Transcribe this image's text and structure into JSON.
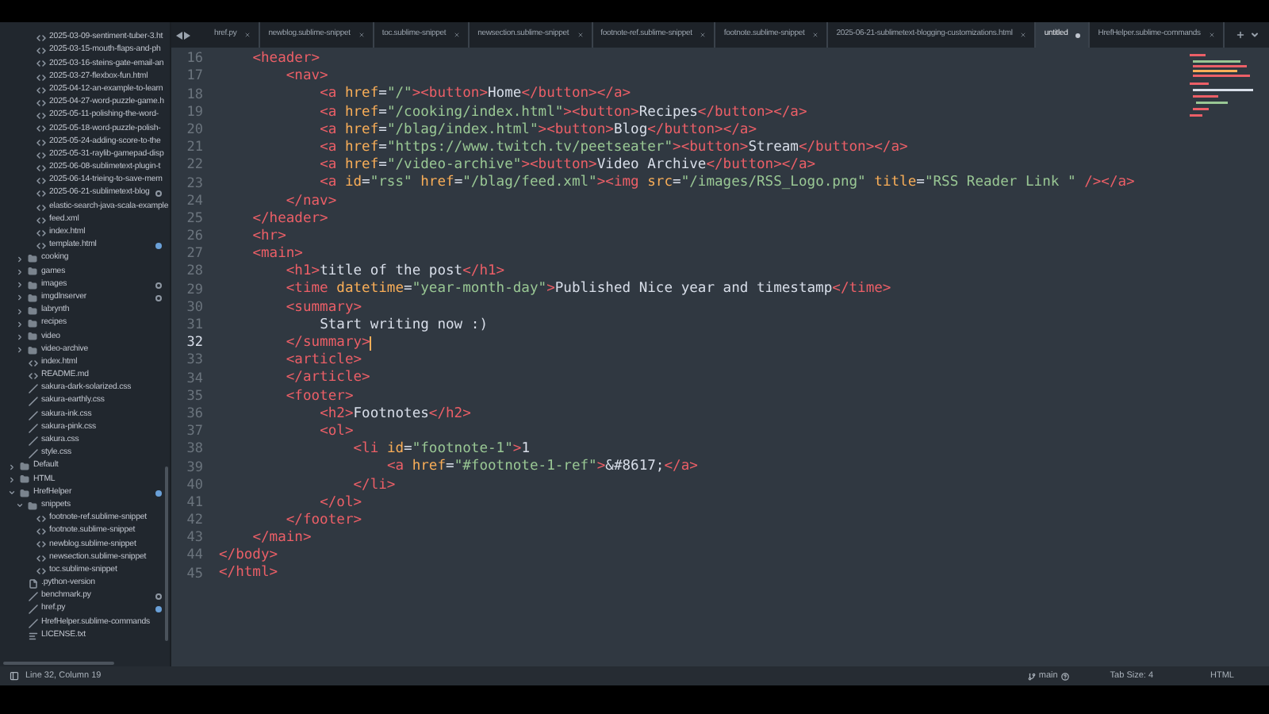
{
  "tabs": [
    {
      "label": "href.py",
      "selected": false,
      "modified": false
    },
    {
      "label": "newblog.sublime-snippet",
      "selected": false,
      "modified": false
    },
    {
      "label": "toc.sublime-snippet",
      "selected": false,
      "modified": false
    },
    {
      "label": "newsection.sublime-snippet",
      "selected": false,
      "modified": false
    },
    {
      "label": "footnote-ref.sublime-snippet",
      "selected": false,
      "modified": false
    },
    {
      "label": "footnote.sublime-snippet",
      "selected": false,
      "modified": false
    },
    {
      "label": "2025-06-21-sublimetext-blogging-customizations.html",
      "selected": false,
      "modified": false
    },
    {
      "label": "untitled",
      "selected": true,
      "modified": true
    },
    {
      "label": "HrefHelper.sublime-commands",
      "selected": false,
      "modified": false
    }
  ],
  "sidebar": {
    "items": [
      {
        "kind": "folder",
        "children": [
          {
            "kind": "folder",
            "children": [
              {
                "kind": "markup",
                "label": "2025-03-09-sentiment-tuber-3.ht",
                "modified": false,
                "untracked": false
              },
              {
                "kind": "markup",
                "label": "2025-03-15-mouth-flaps-and-ph",
                "modified": false,
                "untracked": false
              },
              {
                "kind": "markup",
                "label": "2025-03-16-steins-gate-email-an",
                "modified": false,
                "untracked": false
              },
              {
                "kind": "markup",
                "label": "2025-03-27-flexbox-fun.html",
                "modified": false,
                "untracked": false
              },
              {
                "kind": "markup",
                "label": "2025-04-12-an-example-to-learn",
                "modified": false,
                "untracked": false
              },
              {
                "kind": "markup",
                "label": "2025-04-27-word-puzzle-game.h",
                "modified": false,
                "untracked": false
              },
              {
                "kind": "markup",
                "label": "2025-05-11-polishing-the-word-",
                "modified": false,
                "untracked": false
              },
              {
                "kind": "markup",
                "label": "2025-05-18-word-puzzle-polish-",
                "modified": false,
                "untracked": false
              },
              {
                "kind": "markup",
                "label": "2025-05-24-adding-score-to-the",
                "modified": false,
                "untracked": false
              },
              {
                "kind": "markup",
                "label": "2025-05-31-raylib-gamepad-disp",
                "modified": false,
                "untracked": false
              },
              {
                "kind": "markup",
                "label": "2025-06-08-sublimetext-plugin-t",
                "modified": false,
                "untracked": false
              },
              {
                "kind": "markup",
                "label": "2025-06-14-trieing-to-save-mem",
                "modified": false,
                "untracked": false
              },
              {
                "kind": "markup",
                "label": "2025-06-21-sublimetext-blog",
                "modified": false,
                "untracked": true
              },
              {
                "kind": "markup",
                "label": "elastic-search-java-scala-example",
                "modified": false,
                "untracked": false
              },
              {
                "kind": "markup",
                "label": "feed.xml",
                "modified": false,
                "untracked": false
              },
              {
                "kind": "markup",
                "label": "index.html",
                "modified": false,
                "untracked": false
              },
              {
                "kind": "markup",
                "label": "template.html",
                "modified": true,
                "untracked": false
              }
            ]
          },
          {
            "kind": "folder",
            "label": "cooking",
            "expanded": false,
            "modified": false,
            "untracked": false
          },
          {
            "kind": "folder",
            "label": "games",
            "expanded": false,
            "modified": false,
            "untracked": false
          },
          {
            "kind": "folder",
            "label": "images",
            "expanded": false,
            "modified": false,
            "untracked": true
          },
          {
            "kind": "folder",
            "label": "imgdlnserver",
            "expanded": false,
            "modified": false,
            "untracked": true
          },
          {
            "kind": "folder",
            "label": "labrynth",
            "expanded": false,
            "modified": false,
            "untracked": false
          },
          {
            "kind": "folder",
            "label": "recipes",
            "expanded": false,
            "modified": false,
            "untracked": false
          },
          {
            "kind": "folder",
            "label": "video",
            "expanded": false,
            "modified": false,
            "untracked": false
          },
          {
            "kind": "folder",
            "label": "video-archive",
            "expanded": false,
            "modified": false,
            "untracked": false
          },
          {
            "kind": "markup",
            "label": "index.html",
            "modified": false,
            "untracked": false
          },
          {
            "kind": "markup",
            "label": "README.md",
            "modified": false,
            "untracked": false
          },
          {
            "kind": "script",
            "label": "sakura-dark-solarized.css",
            "modified": false,
            "untracked": false
          },
          {
            "kind": "script",
            "label": "sakura-earthly.css",
            "modified": false,
            "untracked": false
          },
          {
            "kind": "script",
            "label": "sakura-ink.css",
            "modified": false,
            "untracked": false
          },
          {
            "kind": "script",
            "label": "sakura-pink.css",
            "modified": false,
            "untracked": false
          },
          {
            "kind": "script",
            "label": "sakura.css",
            "modified": false,
            "untracked": false
          },
          {
            "kind": "script",
            "label": "style.css",
            "modified": false,
            "untracked": false
          }
        ]
      },
      {
        "kind": "folder",
        "label": "Default",
        "expanded": false,
        "modified": false,
        "untracked": false
      },
      {
        "kind": "folder",
        "label": "HTML",
        "expanded": false,
        "modified": false,
        "untracked": false
      },
      {
        "kind": "folder",
        "label": "HrefHelper",
        "expanded": true,
        "modified": true,
        "untracked": false,
        "children": [
          {
            "kind": "folder",
            "label": "snippets",
            "expanded": true,
            "modified": false,
            "untracked": false,
            "children": [
              {
                "kind": "markup",
                "label": "footnote-ref.sublime-snippet",
                "modified": false,
                "untracked": false
              },
              {
                "kind": "markup",
                "label": "footnote.sublime-snippet",
                "modified": false,
                "untracked": false
              },
              {
                "kind": "markup",
                "label": "newblog.sublime-snippet",
                "modified": false,
                "untracked": false
              },
              {
                "kind": "markup",
                "label": "newsection.sublime-snippet",
                "modified": false,
                "untracked": false
              },
              {
                "kind": "markup",
                "label": "toc.sublime-snippet",
                "modified": false,
                "untracked": false
              }
            ]
          },
          {
            "kind": "file",
            "label": ".python-version",
            "modified": false,
            "untracked": false
          },
          {
            "kind": "script",
            "label": "benchmark.py",
            "modified": false,
            "untracked": true
          },
          {
            "kind": "script",
            "label": "href.py",
            "modified": true,
            "untracked": false
          },
          {
            "kind": "script",
            "label": "HrefHelper.sublime-commands",
            "modified": false,
            "untracked": false
          },
          {
            "kind": "text",
            "label": "LICENSE.txt",
            "modified": false,
            "untracked": false
          }
        ]
      }
    ]
  },
  "editor": {
    "lines": [
      {
        "number": "16",
        "text": "    <header>",
        "current": false
      },
      {
        "number": "17",
        "text": "        <nav>",
        "current": false
      },
      {
        "number": "18",
        "text": "            <a href=\"/\"><button>Home</button></a>",
        "current": false
      },
      {
        "number": "19",
        "text": "            <a href=\"/cooking/index.html\"><button>Recipes</button></a>",
        "current": false
      },
      {
        "number": "20",
        "text": "            <a href=\"/blag/index.html\"><button>Blog</button></a>",
        "current": false
      },
      {
        "number": "21",
        "text": "            <a href=\"https://www.twitch.tv/peetseater\"><button>Stream</button></a>",
        "current": false
      },
      {
        "number": "22",
        "text": "            <a href=\"/video-archive\"><button>Video Archive</button></a>",
        "current": false
      },
      {
        "number": "23",
        "text": "            <a id=\"rss\" href=\"/blag/feed.xml\"><img src=\"/images/RSS_Logo.png\" title=\"RSS Reader Link \" /></a>",
        "current": false
      },
      {
        "number": "24",
        "text": "        </nav>",
        "current": false
      },
      {
        "number": "25",
        "text": "    </header>",
        "current": false
      },
      {
        "number": "26",
        "text": "    <hr>",
        "current": false
      },
      {
        "number": "27",
        "text": "    <main>",
        "current": false
      },
      {
        "number": "28",
        "text": "        <h1>title of the post</h1>",
        "current": false
      },
      {
        "number": "29",
        "text": "        <time datetime=\"year-month-day\">Published Nice year and timestamp</time>",
        "current": false
      },
      {
        "number": "30",
        "text": "        <summary>",
        "current": false
      },
      {
        "number": "31",
        "text": "            Start writing now :)",
        "current": false
      },
      {
        "number": "32",
        "text": "        </summary>",
        "current": true
      },
      {
        "number": "33",
        "text": "        <article>",
        "current": false
      },
      {
        "number": "34",
        "text": "        </article>",
        "current": false
      },
      {
        "number": "35",
        "text": "        <footer>",
        "current": false
      },
      {
        "number": "36",
        "text": "            <h2>Footnotes</h2>",
        "current": false
      },
      {
        "number": "37",
        "text": "            <ol>",
        "current": false
      },
      {
        "number": "38",
        "text": "                <li id=\"footnote-1\">1",
        "current": false
      },
      {
        "number": "39",
        "text": "                    <a href=\"#footnote-1-ref\">&#8617;</a>",
        "current": false
      },
      {
        "number": "40",
        "text": "                </li>",
        "current": false
      },
      {
        "number": "41",
        "text": "            </ol>",
        "current": false
      },
      {
        "number": "42",
        "text": "        </footer>",
        "current": false
      },
      {
        "number": "43",
        "text": "    </main>",
        "current": false
      },
      {
        "number": "44",
        "text": "</body>",
        "current": false
      },
      {
        "number": "45",
        "text": "</html>",
        "current": false
      }
    ]
  },
  "status_bar": {
    "position": "Line 32, Column 19",
    "branch": "main",
    "tab_size": "Tab Size: 4",
    "syntax": "HTML"
  }
}
